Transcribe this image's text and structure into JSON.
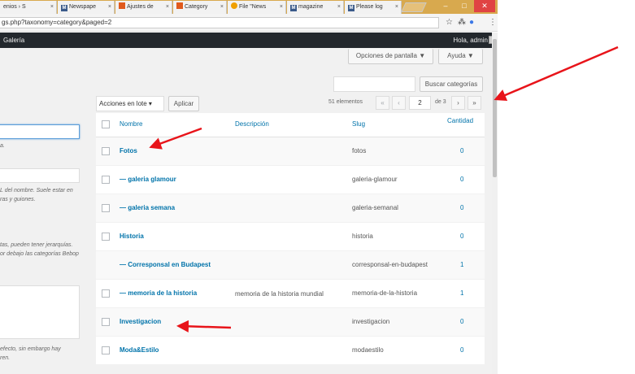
{
  "browser": {
    "tabs": [
      {
        "label": "enios › S",
        "favicon": "wp"
      },
      {
        "label": "Newspape",
        "favicon": "m"
      },
      {
        "label": "Ajustes de",
        "favicon": "wp"
      },
      {
        "label": "Category",
        "favicon": "wp"
      },
      {
        "label": "File \"News",
        "favicon": "file"
      },
      {
        "label": "magazine",
        "favicon": "m"
      },
      {
        "label": "Please log",
        "favicon": "m"
      }
    ],
    "tab_close": "×",
    "url": "gs.php?taxonomy=category&paged=2",
    "favicon_letter": "M",
    "window_buttons": [
      "–",
      "□",
      "✕"
    ],
    "star_icon": "☆",
    "ext_icon_1": "⁂",
    "ext_icon_2": "●",
    "menu_icon": "⋮"
  },
  "adminbar": {
    "left_label": "Galería",
    "greeting": "Hola, admin"
  },
  "screen_options_label": "Opciones de pantalla ▼",
  "help_label": "Ayuda ▼",
  "search": {
    "value": "",
    "button_label": "Buscar categorías"
  },
  "bulk": {
    "select_value": "Acciones en lote ▾",
    "apply_label": "Aplicar"
  },
  "pagination": {
    "count_label": "51 elementos",
    "first": "«",
    "prev": "‹",
    "current": "2",
    "of_label": "de 3",
    "next": "›",
    "last": "»"
  },
  "left_form": {
    "hint_1": "a.",
    "hint_2a": "L del nombre. Suele estar en",
    "hint_2b": "ras y guiones.",
    "hint_3a": "tas, pueden tener jerarquías.",
    "hint_3b": "or debajo las categorías Bebop",
    "hint_4a": "efecto, sin embargo hay",
    "hint_4b": "ren."
  },
  "table": {
    "headers": {
      "name": "Nombre",
      "desc": "Descripción",
      "slug": "Slug",
      "count": "Cantidad"
    },
    "rows": [
      {
        "name": "Fotos",
        "desc": "",
        "slug": "fotos",
        "count": "0"
      },
      {
        "name": "— galeria glamour",
        "desc": "",
        "slug": "galeria-glamour",
        "count": "0"
      },
      {
        "name": "— galeria semana",
        "desc": "",
        "slug": "galeria-semanal",
        "count": "0"
      },
      {
        "name": "Historia",
        "desc": "",
        "slug": "historia",
        "count": "0"
      },
      {
        "name": "— Corresponsal en Budapest",
        "desc": "",
        "slug": "corresponsal-en-budapest",
        "count": "1"
      },
      {
        "name": "— memoria de la historia",
        "desc": "memoria de la historia mundial",
        "slug": "memoria-de-la-historia",
        "count": "1"
      },
      {
        "name": "Investigacion",
        "desc": "",
        "slug": "investigacion",
        "count": "0"
      },
      {
        "name": "Moda&Estilo",
        "desc": "",
        "slug": "modaestilo",
        "count": "0"
      }
    ]
  },
  "colors": {
    "annotation_arrow": "#e8141a",
    "link": "#0073aa",
    "adminbar": "#23282d"
  }
}
